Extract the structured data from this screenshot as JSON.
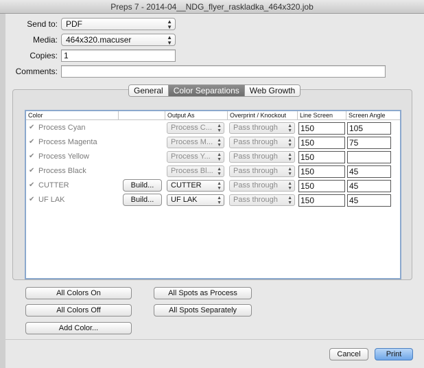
{
  "window": {
    "title": "Preps 7 - 2014-04__NDG_flyer_raskladka_464x320.job"
  },
  "form": {
    "send_to_label": "Send to:",
    "send_to_value": "PDF",
    "media_label": "Media:",
    "media_value": "464x320.macuser",
    "copies_label": "Copies:",
    "copies_value": "1",
    "comments_label": "Comments:",
    "comments_value": ""
  },
  "tabs": [
    {
      "label": "General",
      "active": false
    },
    {
      "label": "Color Separations",
      "active": true
    },
    {
      "label": "Web Growth",
      "active": false
    }
  ],
  "table": {
    "headers": {
      "color": "Color",
      "output_as": "Output As",
      "overprint": "Overprint / Knockout",
      "line_screen": "Line Screen",
      "screen_angle": "Screen Angle"
    },
    "rows": [
      {
        "name": "Process Cyan",
        "build": "",
        "output": "Process C...",
        "overprint": "Pass through",
        "line_screen": "150",
        "angle": "105"
      },
      {
        "name": "Process Magenta",
        "build": "",
        "output": "Process M...",
        "overprint": "Pass through",
        "line_screen": "150",
        "angle": "75"
      },
      {
        "name": "Process Yellow",
        "build": "",
        "output": "Process Y...",
        "overprint": "Pass through",
        "line_screen": "150",
        "angle": ""
      },
      {
        "name": "Process Black",
        "build": "",
        "output": "Process Bl...",
        "overprint": "Pass through",
        "line_screen": "150",
        "angle": "45"
      },
      {
        "name": "CUTTER",
        "build": "Build...",
        "output": "CUTTER",
        "overprint": "Pass through",
        "line_screen": "150",
        "angle": "45"
      },
      {
        "name": "UF LAK",
        "build": "Build...",
        "output": "UF LAK",
        "overprint": "Pass through",
        "line_screen": "150",
        "angle": "45"
      }
    ]
  },
  "buttons": {
    "all_colors_on": "All Colors On",
    "all_colors_off": "All Colors Off",
    "add_color": "Add Color...",
    "all_spots_process": "All Spots as Process",
    "all_spots_separately": "All Spots Separately",
    "cancel": "Cancel",
    "print": "Print"
  },
  "checkmark_glyph": "✔",
  "colors": {
    "accent": "#6fa6e8",
    "table_border": "#8ba8cd"
  }
}
